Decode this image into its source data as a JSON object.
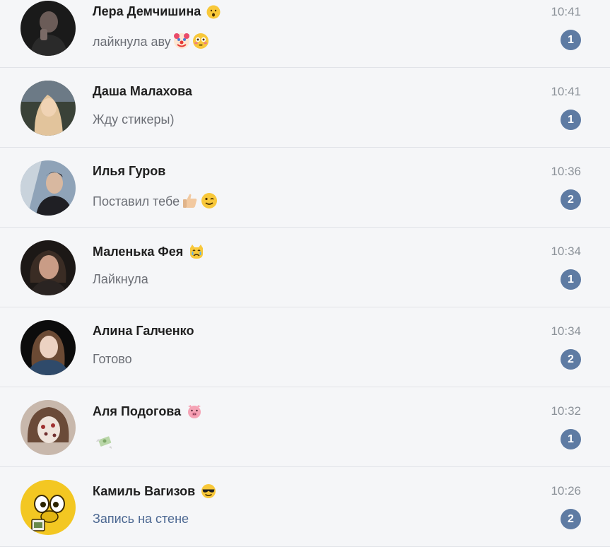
{
  "dialogs": [
    {
      "name": "Лера Демчишина",
      "message": "лайкнула аву",
      "time": "10:41",
      "unread": "1",
      "name_emoji": "open-mouth-emoji",
      "msg_emojis": [
        "clown-face-emoji",
        "flushed-face-emoji"
      ]
    },
    {
      "name": "Даша Малахова",
      "message": "Жду стикеры)",
      "time": "10:41",
      "unread": "1"
    },
    {
      "name": "Илья Гуров",
      "message": "Поставил тебе",
      "time": "10:36",
      "unread": "2",
      "msg_emojis": [
        "thumbs-up-emoji",
        "wink-face-emoji"
      ]
    },
    {
      "name": "Маленька Фея",
      "message": "Лайкнула",
      "time": "10:34",
      "unread": "1",
      "name_emoji": "crying-cat-emoji"
    },
    {
      "name": "Алина Галченко",
      "message": "Готово",
      "time": "10:34",
      "unread": "2"
    },
    {
      "name": "Аля Подогова",
      "message": "",
      "time": "10:32",
      "unread": "1",
      "name_emoji": "pig-face-emoji",
      "msg_emojis": [
        "money-with-wings-emoji"
      ]
    },
    {
      "name": "Камиль Вагизов",
      "message": "Запись на стене",
      "time": "10:26",
      "unread": "2",
      "name_emoji": "sunglasses-face-emoji",
      "message_style": "link"
    }
  ],
  "colors": {
    "background": "#f5f6f8",
    "divider": "#e1e3e8",
    "badge": "#5e7ba3",
    "time": "#8c9299",
    "message": "#6c6f76",
    "link": "#4b6791"
  }
}
